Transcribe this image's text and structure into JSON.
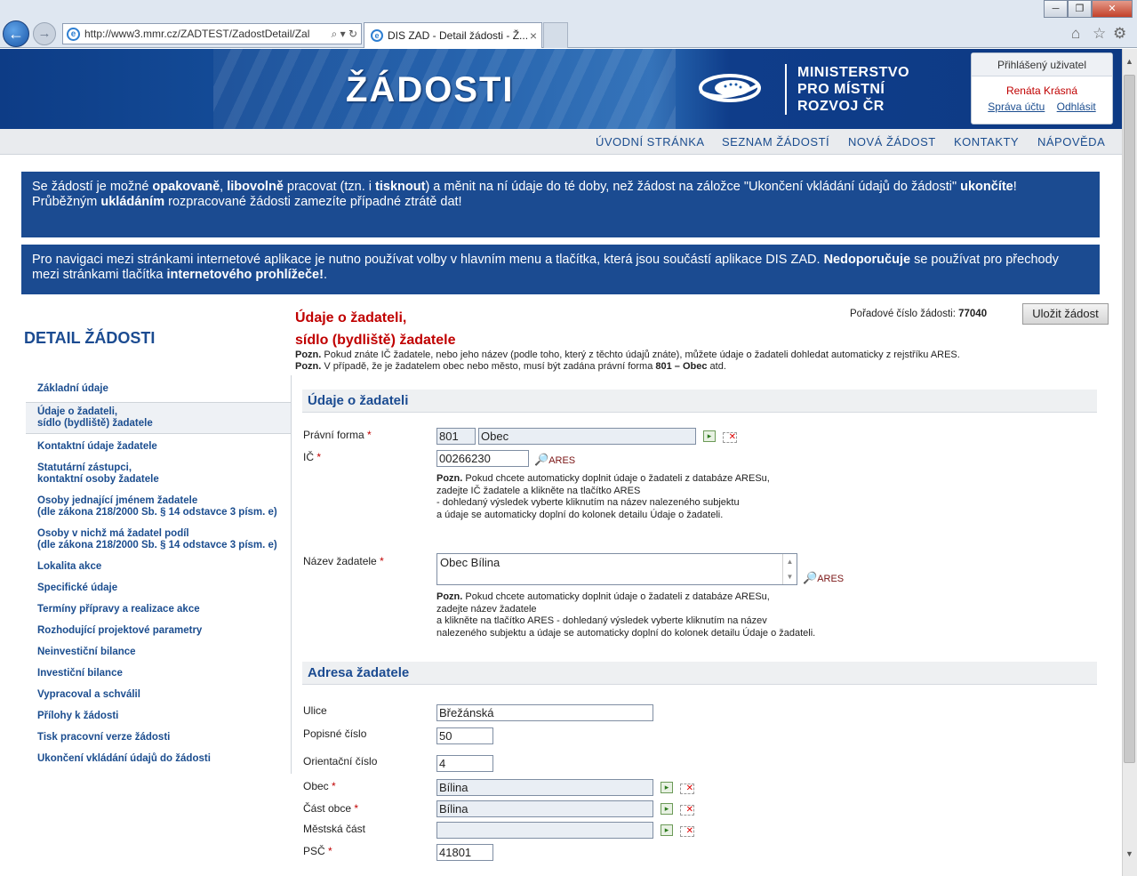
{
  "browser": {
    "url": "http://www3.mmr.cz/ZADTEST/ZadostDetail/Zal",
    "tab_title": "DIS ZAD - Detail žádosti - Ž...",
    "tab_close": "×",
    "window_controls": {
      "min": "─",
      "max": "❐",
      "close": "✕"
    },
    "nav": {
      "back": "←",
      "forward": "→"
    },
    "addr_tools": "⌕ ▾ ↻",
    "toolbar_icons": {
      "home": "⌂",
      "favorites": "☆",
      "settings": "⚙"
    }
  },
  "header": {
    "site_title": "ŽÁDOSTI",
    "ministry_lines": [
      "MINISTERSTVO",
      "PRO MÍSTNÍ",
      "ROZVOJ ČR"
    ]
  },
  "user": {
    "heading": "Přihlášený uživatel",
    "name": "Renáta Krásná",
    "account_link": "Správa účtu",
    "logout_link": "Odhlásit"
  },
  "menu": [
    "ÚVODNÍ STRÁNKA",
    "SEZNAM ŽÁDOSTÍ",
    "NOVÁ ŽÁDOST",
    "KONTAKTY",
    "NÁPOVĚDA"
  ],
  "notice1": {
    "p1": "Se žádostí je možné ",
    "b1": "opakovaně",
    "p2": ", ",
    "b2": "libovolně",
    "p3": " pracovat (tzn. i ",
    "b3": "tisknout",
    "p4": ") a měnit na ní údaje do té doby, než žádost na záložce \"Ukončení vkládání údajů do žádosti\" ",
    "b4": "ukončíte",
    "p5": "!",
    "p6": "Průběžným ",
    "b5": "ukládáním",
    "p7": " rozpracované žádosti zamezíte případné ztrátě dat!"
  },
  "notice2": {
    "p1": "Pro navigaci mezi stránkami internetové aplikace je nutno používat volby v hlavním menu a tlačítka, která jsou součástí aplikace DIS ZAD. ",
    "b1": "Nedoporučuje",
    "p2": " se používat pro přechody mezi stránkami tlačítka ",
    "b2": "internetového prohlížeče!",
    "p3": "."
  },
  "left": {
    "title": "DETAIL ŽÁDOSTI",
    "items": [
      "Základní údaje",
      "Údaje o žadateli,\nsídlo (bydliště) žadatele",
      "Kontaktní údaje žadatele",
      "Statutární zástupci,\nkontaktní osoby žadatele",
      "Osoby jednající jménem žadatele\n(dle zákona 218/2000 Sb. § 14 odstavce 3 písm. e)",
      "Osoby v nichž má žadatel podíl\n(dle zákona 218/2000 Sb. § 14 odstavce 3 písm. e)",
      "Lokalita akce",
      "Specifické údaje",
      "Termíny přípravy a realizace akce",
      "Rozhodující projektové parametry",
      "Neinvestiční bilance",
      "Investiční bilance",
      "Vypracoval a schválil",
      "Přílohy k žádosti",
      "Tisk pracovní verze žádosti",
      "Ukončení vkládání údajů do žádosti"
    ]
  },
  "main": {
    "title_line1": "Údaje o žadateli,",
    "title_line2": "sídlo (bydliště) žadatele",
    "order_label": "Pořadové číslo žádosti:",
    "order_number": "77040",
    "save_button": "Uložit žádost",
    "note_prefix": "Pozn.",
    "note1": " Pokud znáte IČ žadatele, nebo jeho název (podle toho, který z těchto údajů znáte), můžete údaje o žadateli dohledat automaticky z rejstříku ARES.",
    "note2a": " V případě, že je žadatelem obec nebo město, musí být zadána právní forma ",
    "note2b": "801 – Obec",
    "note2c": " atd.",
    "section1": "Údaje o žadateli",
    "section2": "Adresa žadatele",
    "required_mark": "*",
    "ares": "ARES",
    "ares_icon": "🔎",
    "pick_icon": "▸",
    "clear_icon": "✕",
    "scroll_arrows": {
      "up": "▲",
      "down": "▼"
    },
    "fields": {
      "legal_form": {
        "label": "Právní forma",
        "code": "801",
        "name": "Obec"
      },
      "ico": {
        "label": "IČ",
        "value": "00266230"
      },
      "ico_hint": {
        "line1a": "Pozn.",
        "line1b": " Pokud chcete automaticky doplnit údaje o žadateli z databáze ARESu,",
        "line2": "zadejte IČ žadatele a klikněte na tlačítko ARES",
        "line3": "- dohledaný výsledek vyberte kliknutím na název nalezeného subjektu",
        "line4": "a údaje se automaticky doplní do kolonek detailu Údaje o žadateli."
      },
      "name": {
        "label": "Název žadatele",
        "value": "Obec Bílina"
      },
      "name_hint": {
        "line1a": "Pozn.",
        "line1b": " Pokud chcete automaticky doplnit údaje o žadateli z databáze ARESu,",
        "line2": "zadejte název žadatele",
        "line3": "a klikněte na tlačítko ARES - dohledaný výsledek vyberte kliknutím na název",
        "line4": "nalezeného subjektu a údaje se automaticky doplní do kolonek detailu Údaje o žadateli."
      },
      "street": {
        "label": "Ulice",
        "value": "Břežánská"
      },
      "house_no": {
        "label": "Popisné číslo",
        "value": "50"
      },
      "orient_no": {
        "label": "Orientační číslo",
        "value": "4"
      },
      "municipality": {
        "label": "Obec",
        "value": "Bílina"
      },
      "municipality_part": {
        "label": "Část obce",
        "value": "Bílina"
      },
      "city_district": {
        "label": "Městská část",
        "value": ""
      },
      "zip": {
        "label": "PSČ",
        "value": "41801"
      }
    }
  }
}
